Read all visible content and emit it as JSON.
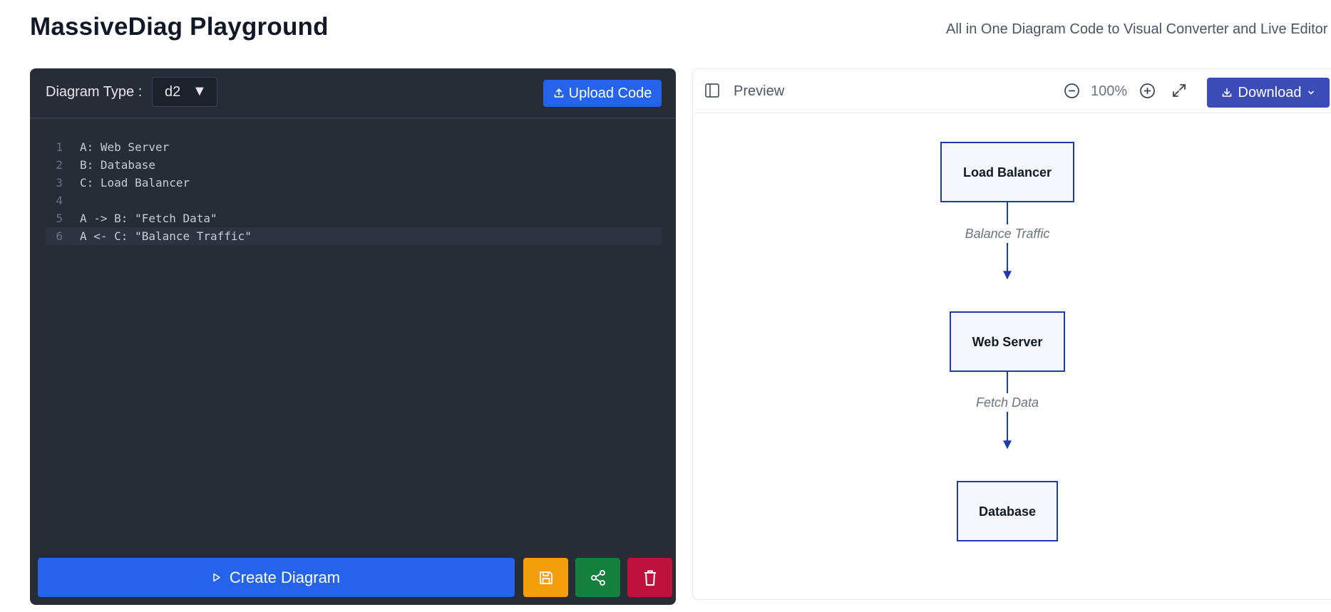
{
  "app": {
    "title": "MassiveDiag Playground",
    "subtitle": "All in One Diagram Code to Visual Converter and Live Editor"
  },
  "editor": {
    "diagram_type_label": "Diagram Type :",
    "diagram_type_value": "d2",
    "upload_label": "Upload Code",
    "lines": [
      {
        "num": "1",
        "text": "A: Web Server"
      },
      {
        "num": "2",
        "text": "B: Database"
      },
      {
        "num": "3",
        "text": "C: Load Balancer"
      },
      {
        "num": "4",
        "text": ""
      },
      {
        "num": "5",
        "text": "A -> B: \"Fetch Data\""
      },
      {
        "num": "6",
        "text": "A <- C: \"Balance Traffic\""
      }
    ],
    "create_label": "Create Diagram"
  },
  "preview": {
    "label": "Preview",
    "zoom": "100%",
    "download_label": "Download",
    "nodes": {
      "load_balancer": "Load Balancer",
      "web_server": "Web Server",
      "database": "Database"
    },
    "edges": {
      "balance_traffic": "Balance Traffic",
      "fetch_data": "Fetch Data"
    }
  },
  "colors": {
    "accent": "#2563eb",
    "editor_bg": "#282c37",
    "node_border": "#1e3aa8",
    "node_fill": "#f5f7fd",
    "download": "#3b4cb8",
    "save": "#f59e0b",
    "share": "#15803d",
    "delete": "#be123c"
  }
}
